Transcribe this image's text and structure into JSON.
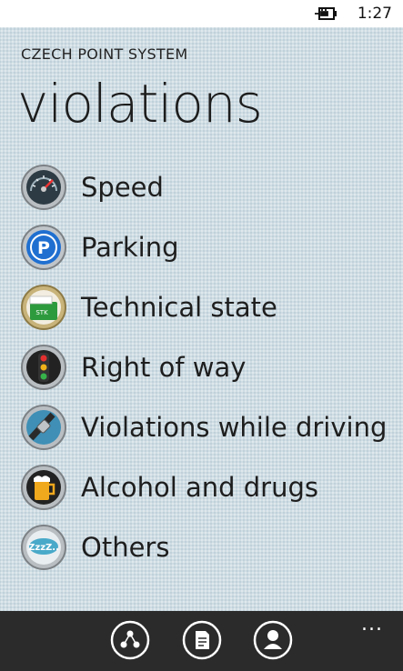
{
  "status": {
    "time": "1:27",
    "power_icon": "charging-plug-icon"
  },
  "header": {
    "app_title": "CZECH POINT SYSTEM",
    "page_title": "violations"
  },
  "menu": [
    {
      "label": "Speed",
      "icon": "speedometer-icon"
    },
    {
      "label": "Parking",
      "icon": "parking-icon"
    },
    {
      "label": "Technical state",
      "icon": "stk-document-icon"
    },
    {
      "label": "Right of way",
      "icon": "traffic-light-icon"
    },
    {
      "label": "Violations while driving",
      "icon": "seatbelt-icon"
    },
    {
      "label": "Alcohol and drugs",
      "icon": "beer-icon"
    },
    {
      "label": "Others",
      "icon": "zzz-icon"
    }
  ],
  "appbar": {
    "buttons": [
      "share-icon",
      "document-icon",
      "person-icon"
    ],
    "more": "..."
  },
  "colors": {
    "background": "#cfdde4",
    "appbar": "#2b2b2b",
    "parking_blue": "#1f6fd0"
  }
}
